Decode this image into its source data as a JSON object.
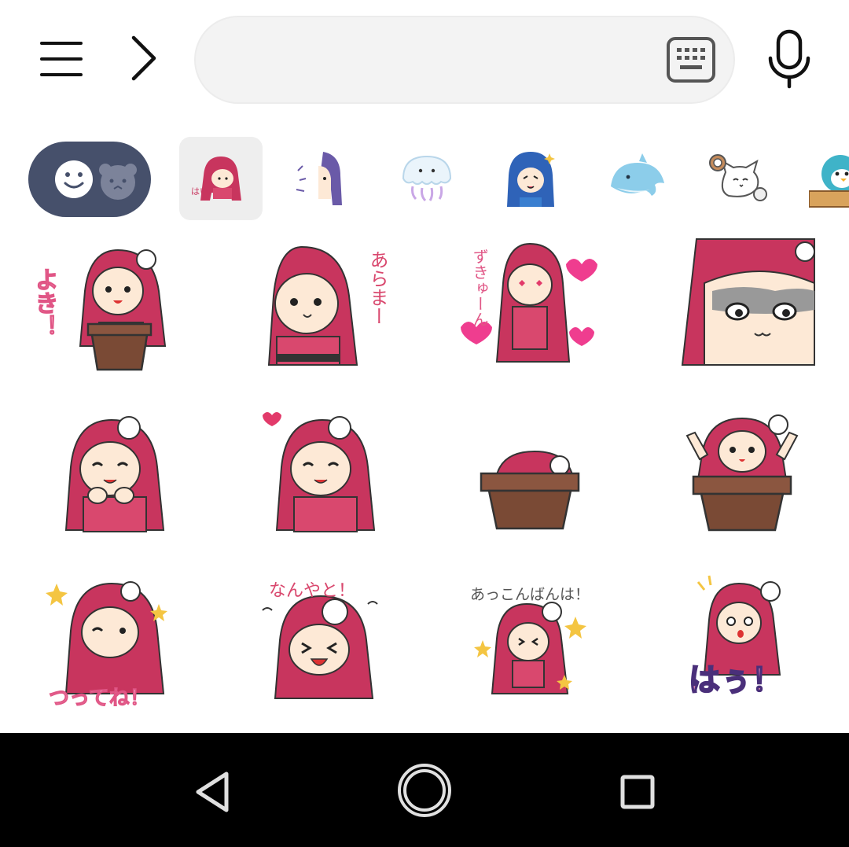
{
  "toolbar": {
    "menu_icon": "hamburger-menu-icon",
    "expand_icon": "chevron-right-icon",
    "search": {
      "value": "",
      "placeholder": ""
    },
    "keyboard_icon": "keyboard-icon",
    "mic_icon": "microphone-icon"
  },
  "colors": {
    "toggle_bg": "#46506b",
    "search_bg": "#f3f3f3",
    "hair": "#c8355e",
    "skin": "#fde9d6",
    "pot": "#7a4a35",
    "navbar": "#000000"
  },
  "tabs": {
    "emoji_toggle": [
      "smiley-face-icon",
      "bear-face-icon"
    ],
    "packs": [
      {
        "icon": "red-hair-girl-sticker-pack",
        "selected": true,
        "text": "はい。"
      },
      {
        "icon": "purple-hair-girl-sticker-pack",
        "selected": false,
        "text": ""
      },
      {
        "icon": "jellyfish-sticker-pack",
        "selected": false,
        "text": ""
      },
      {
        "icon": "blue-hair-girl-sticker-pack",
        "selected": false,
        "text": ""
      },
      {
        "icon": "dolphin-sticker-pack",
        "selected": false,
        "text": ""
      },
      {
        "icon": "white-cat-sticker-pack",
        "selected": false,
        "text": ""
      },
      {
        "icon": "penguin-sticker-pack",
        "selected": false,
        "text": ""
      }
    ]
  },
  "stickers": [
    {
      "name": "yoshi-pot",
      "text": "よき！"
    },
    {
      "name": "arama",
      "text": "あらまー"
    },
    {
      "name": "suki-hearts",
      "text": "ずきゅーん"
    },
    {
      "name": "smug-face",
      "text": ""
    },
    {
      "name": "happy-hands",
      "text": ""
    },
    {
      "name": "happy-heart",
      "text": ""
    },
    {
      "name": "hiding-in-pot",
      "text": ""
    },
    {
      "name": "arms-up-pot",
      "text": ""
    },
    {
      "name": "tsuttene-wink",
      "text": "つってね！"
    },
    {
      "name": "nanyato",
      "text": "なんやと！"
    },
    {
      "name": "akkonbanwa",
      "text": "あっこんばんは！"
    },
    {
      "name": "hau-surprised",
      "text": "はぅ！"
    }
  ],
  "navbar": {
    "back_icon": "back-triangle-icon",
    "home_icon": "home-circle-icon",
    "recent_icon": "recent-apps-square-icon"
  }
}
